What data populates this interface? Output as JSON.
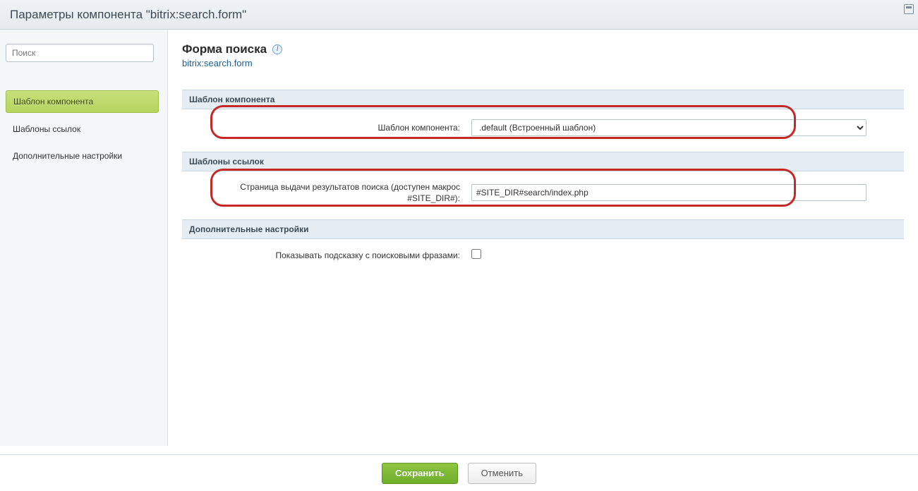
{
  "window": {
    "title": "Параметры компонента \"bitrix:search.form\""
  },
  "sidebar": {
    "search_placeholder": "Поиск",
    "items": [
      {
        "label": "Шаблон компонента",
        "active": true
      },
      {
        "label": "Шаблоны ссылок",
        "active": false
      },
      {
        "label": "Дополнительные настройки",
        "active": false
      }
    ]
  },
  "header": {
    "title": "Форма поиска",
    "component": "bitrix:search.form"
  },
  "sections": {
    "template": {
      "title": "Шаблон компонента",
      "field_label": "Шаблон компонента:",
      "field_value": ".default (Встроенный шаблон)"
    },
    "links": {
      "title": "Шаблоны ссылок",
      "field_label": "Страница выдачи результатов поиска (доступен макрос #SITE_DIR#):",
      "field_value": "#SITE_DIR#search/index.php"
    },
    "extra": {
      "title": "Дополнительные настройки",
      "field_label": "Показывать подсказку с поисковыми фразами:",
      "field_checked": false
    }
  },
  "footer": {
    "save": "Сохранить",
    "cancel": "Отменить"
  }
}
